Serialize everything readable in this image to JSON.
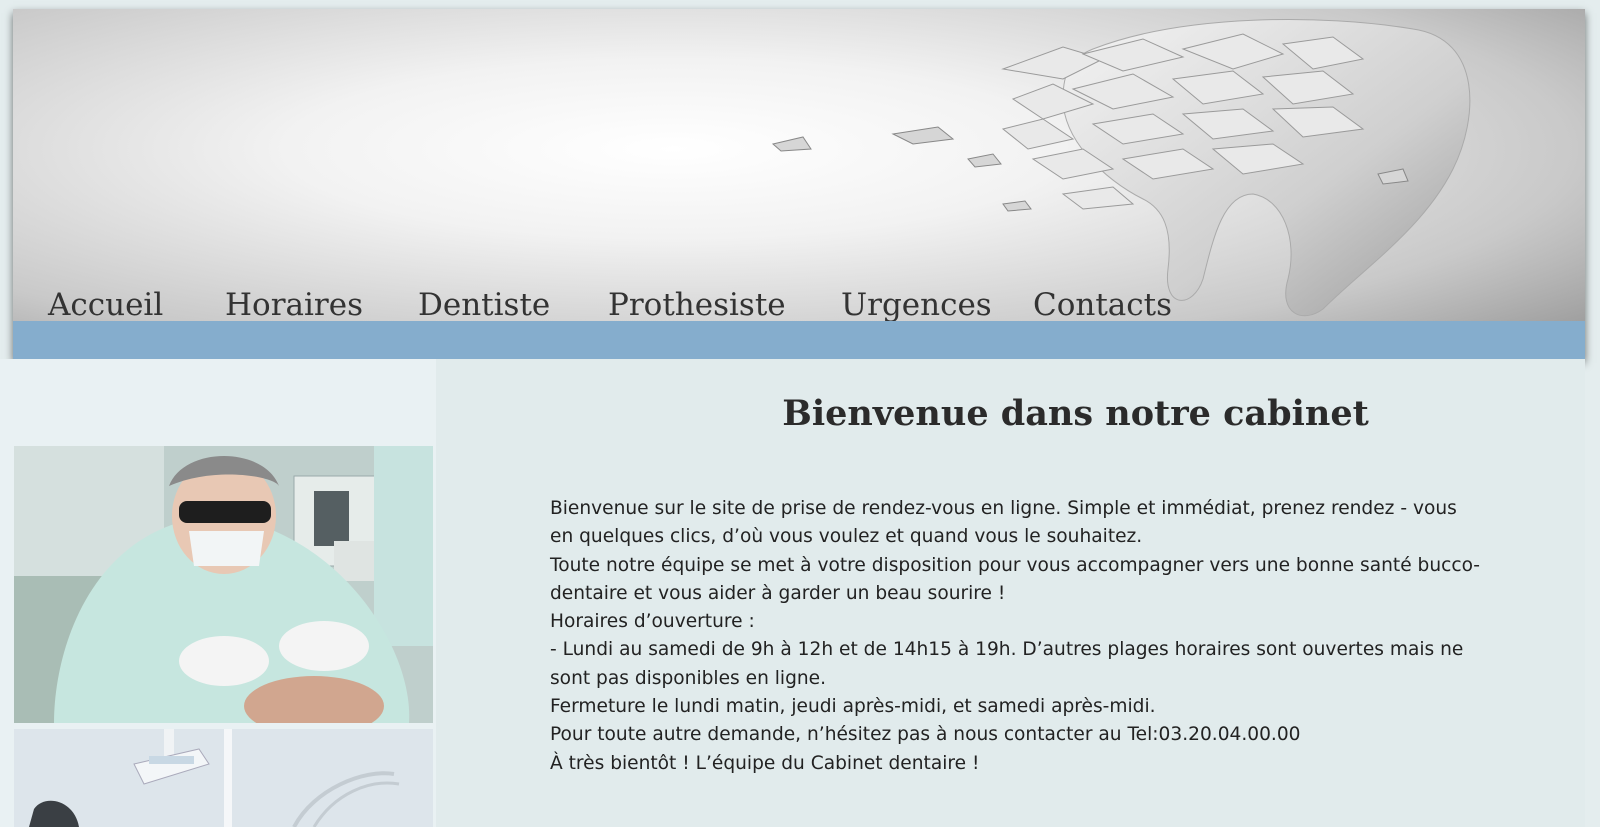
{
  "nav": {
    "items": [
      "Accueil",
      "Horaires",
      "Dentiste",
      "Prothesiste",
      "Urgences",
      "Contacts"
    ],
    "bar_color": "#85adcd"
  },
  "main": {
    "title": "Bienvenue dans notre cabinet",
    "paragraphs": [
      "Bienvenue sur le site de prise de rendez-vous en ligne. Simple et immédiat, prenez rendez - vous en quelques clics, d’où vous voulez et quand vous le souhaitez.",
      "Toute notre équipe se met à votre disposition pour vous accompagner vers une bonne santé bucco-dentaire et vous aider à garder un beau sourire !",
      "Horaires d’ouverture :",
      "- Lundi au samedi de 9h à 12h et de 14h15 à 19h. D’autres plages horaires sont ouvertes mais ne sont pas disponibles en ligne.",
      "Fermeture le lundi matin, jeudi après-midi, et samedi après-midi.",
      "Pour toute autre demande, n’hésitez pas à nous contacter au Tel:03.20.04.00.00",
      "À très bientôt ! L’équipe du Cabinet dentaire !"
    ]
  },
  "icons": {
    "header_art": "shattered-tooth-icon",
    "photo_1": "dentist-at-work-photo",
    "photo_2": "dental-chair-photo"
  }
}
